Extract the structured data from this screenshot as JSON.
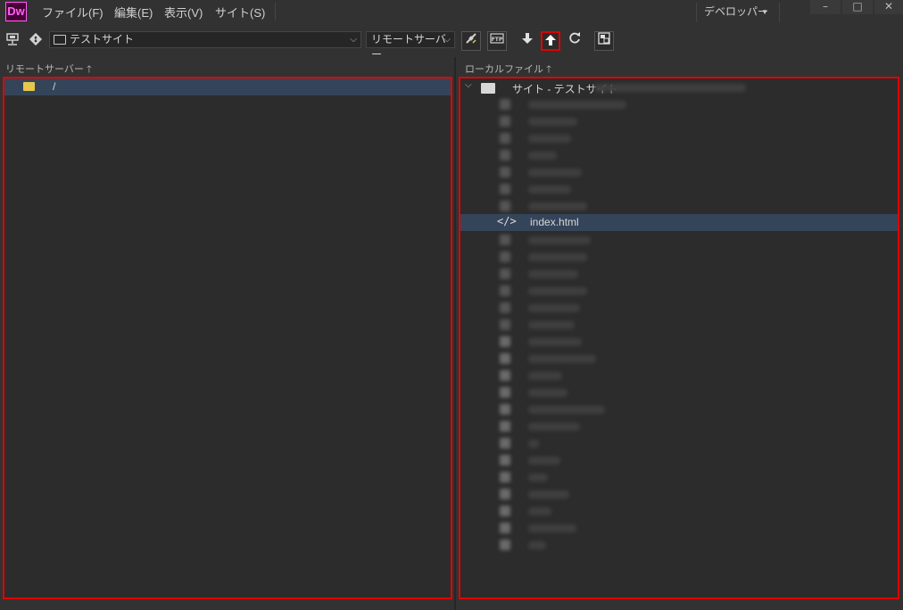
{
  "app": {
    "logo": "Dw"
  },
  "menu": {
    "file": "ファイル(F)",
    "edit": "編集(E)",
    "view": "表示(V)",
    "site": "サイト(S)"
  },
  "workspace": {
    "label": "デベロッパー"
  },
  "window_controls": {
    "minimize": "–",
    "maximize": "□",
    "close": "✕"
  },
  "toolbar": {
    "site_name": "テストサイト",
    "server_view": "リモートサーバー"
  },
  "remote_pane": {
    "header": "リモートサーバー",
    "root": "/"
  },
  "local_pane": {
    "header": "ローカルファイル",
    "root": "サイト - テストサイト",
    "visible_file": "index.html"
  },
  "colors": {
    "highlight_border": "#e00000",
    "selected_row": "#34455a",
    "dw_brand": "#ff61f6"
  },
  "icons": [
    "connection-icon",
    "git-icon",
    "connect-icon",
    "ftp-log-icon",
    "get-icon",
    "put-icon",
    "refresh-icon",
    "expand-icon"
  ]
}
